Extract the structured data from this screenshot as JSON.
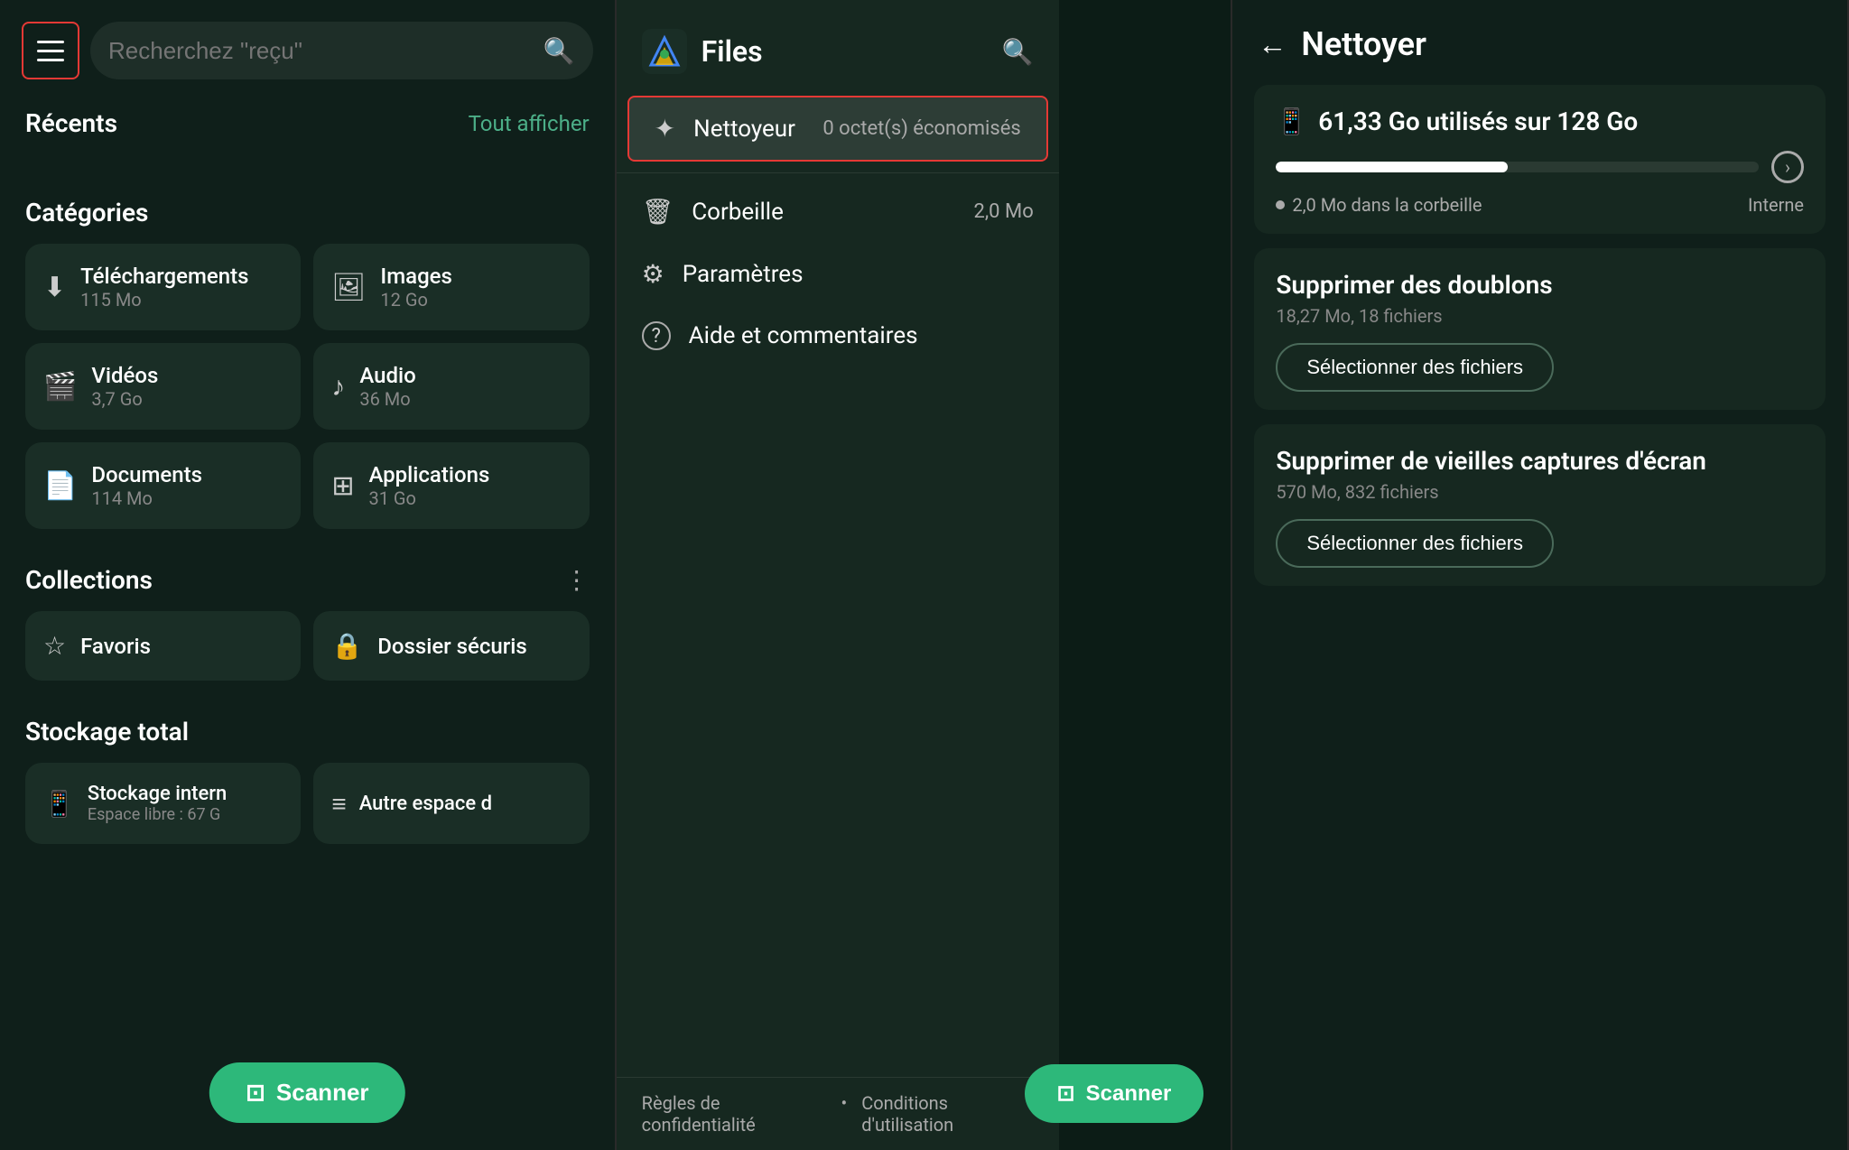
{
  "panel1": {
    "search_placeholder": "Recherchez \"reçu\"",
    "recents_label": "Récents",
    "tout_afficher": "Tout afficher",
    "categories_label": "Catégories",
    "categories": [
      {
        "icon": "⬇",
        "name": "Téléchargements",
        "size": "115 Mo"
      },
      {
        "icon": "🖼",
        "name": "Images",
        "size": "12 Go"
      },
      {
        "icon": "🎬",
        "name": "Vidéos",
        "size": "3,7 Go"
      },
      {
        "icon": "♪",
        "name": "Audio",
        "size": "36 Mo"
      },
      {
        "icon": "📄",
        "name": "Documents",
        "size": "114 Mo"
      },
      {
        "icon": "⊞",
        "name": "Applications",
        "size": "31 Go"
      }
    ],
    "collections_label": "Collections",
    "collections": [
      {
        "icon": "☆",
        "name": "Favoris"
      },
      {
        "icon": "🔒",
        "name": "Dossier sécuris"
      }
    ],
    "stockage_label": "Stockage total",
    "storages": [
      {
        "icon": "📱",
        "name": "Stockage intern",
        "sub": "Espace libre : 67 G"
      },
      {
        "icon": "≡",
        "name": "Autre espace d",
        "sub": ""
      }
    ],
    "scanner_label": "Scanner"
  },
  "panel2": {
    "drawer_title": "Files",
    "items": [
      {
        "icon": "✦",
        "label": "Nettoyeur",
        "badge": "0 octet(s) économisés",
        "active": true
      },
      {
        "icon": "🗑",
        "label": "Corbeille",
        "badge": "2,0 Mo"
      },
      {
        "icon": "⚙",
        "label": "Paramètres",
        "badge": ""
      },
      {
        "icon": "?",
        "label": "Aide et commentaires",
        "badge": ""
      }
    ],
    "footer_links": [
      "Règles de confidentialité",
      "Conditions d'utilisation"
    ],
    "scanner_label": "Scanner"
  },
  "panel3": {
    "back_label": "←",
    "title": "Nettoyer",
    "storage_title": "61,33 Go utilisés sur 128 Go",
    "storage_meta": "2,0 Mo dans la corbeille",
    "storage_type": "Interne",
    "progress_percent": 48,
    "cards": [
      {
        "title": "Supprimer des doublons",
        "sub": "18,27 Mo, 18 fichiers",
        "btn": "Sélectionner des fichiers"
      },
      {
        "title": "Supprimer de vieilles captures d'écran",
        "sub": "570 Mo, 832 fichiers",
        "btn": "Sélectionner des fichiers"
      }
    ]
  }
}
